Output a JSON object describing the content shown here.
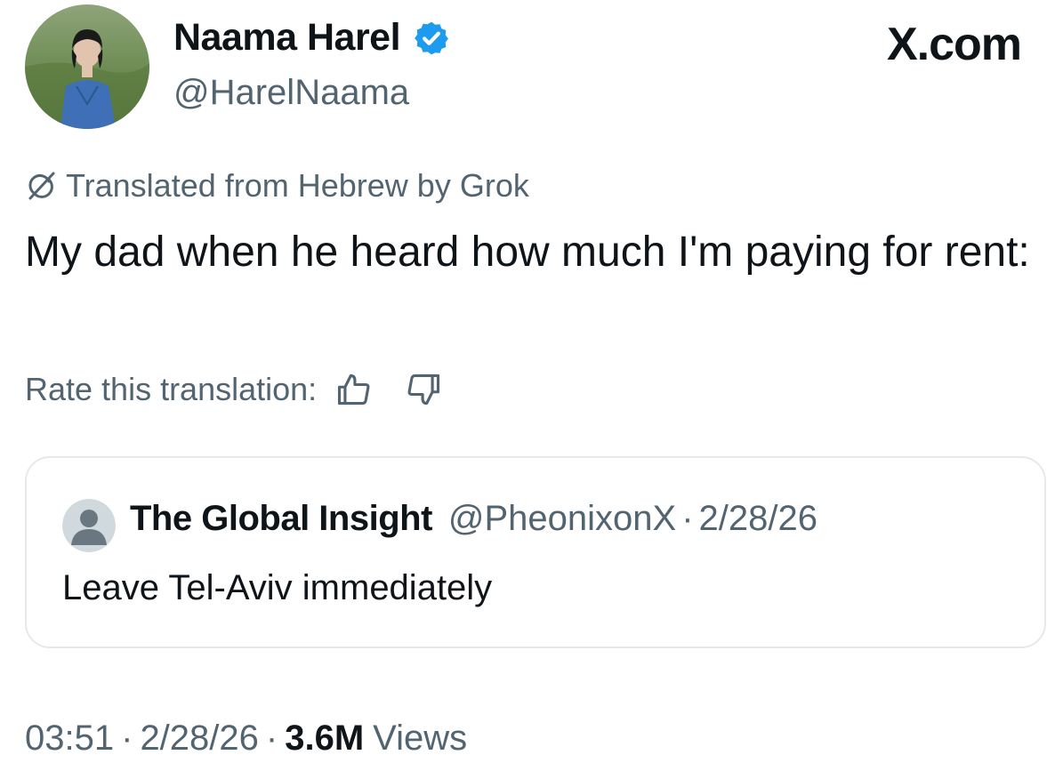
{
  "author": {
    "name": "Naama Harel",
    "handle": "@HarelNaama",
    "verified": true,
    "verified_color": "#1d9bf0"
  },
  "brand": {
    "label": "X.com"
  },
  "translation": {
    "notice": "Translated from Hebrew by Grok",
    "icon": "grok-icon",
    "rate_label": "Rate this translation:",
    "rate_icons": [
      "thumbs-up-icon",
      "thumbs-down-icon"
    ]
  },
  "tweet": {
    "text": "My dad when he heard how much I'm paying for rent:"
  },
  "quote": {
    "name": "The Global Insight",
    "handle": "@PheonixonX",
    "separator": "·",
    "date": "2/28/26",
    "text": "Leave Tel-Aviv immediately",
    "avatar_icon": "default-avatar-icon"
  },
  "meta": {
    "time": "03:51",
    "separator": "·",
    "date": "2/28/26",
    "views_count": "3.6M",
    "views_label": "Views"
  },
  "colors": {
    "text_primary": "#0f1419",
    "text_secondary": "#536471",
    "border": "#e6e9eb",
    "accent": "#1d9bf0"
  }
}
